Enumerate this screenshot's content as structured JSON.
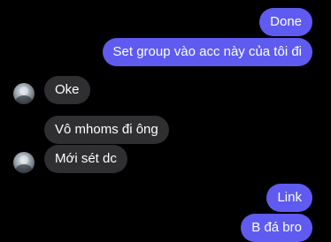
{
  "messages": [
    {
      "side": "out",
      "text": "Done"
    },
    {
      "side": "out",
      "text": "Set group vào acc này của tôi đi"
    },
    {
      "side": "in",
      "text": "Oke"
    },
    {
      "side": "in",
      "text": "Vô mhoms đi ông"
    },
    {
      "side": "in",
      "text": "Mới sét dc"
    },
    {
      "side": "out",
      "text": "Link"
    },
    {
      "side": "out",
      "text": "B đá bro"
    }
  ],
  "colors": {
    "background": "#000000",
    "outgoing_bubble": "#5f5bf0",
    "incoming_bubble": "#2f2f31",
    "text": "#ffffff"
  },
  "icons": {
    "avatar": "contact-avatar-photo"
  }
}
